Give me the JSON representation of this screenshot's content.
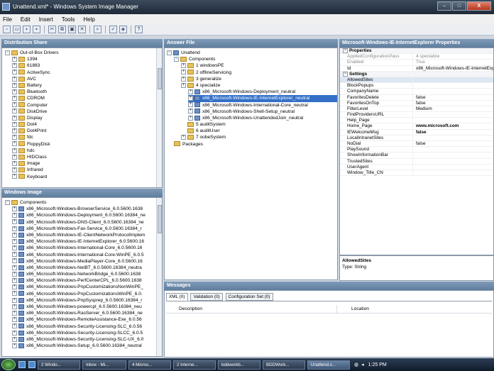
{
  "window": {
    "title": "Unattend.xml* - Windows System Image Manager",
    "min": "–",
    "max": "□",
    "close": "X"
  },
  "menu": [
    "File",
    "Edit",
    "Insert",
    "Tools",
    "Help"
  ],
  "distribution_share": {
    "header": "Distribution Share",
    "root": "Out-of-Box Drivers",
    "items": [
      "1394",
      "61883",
      "ActiveSync",
      "AVC",
      "Battery",
      "Bluetooth",
      "CDROM",
      "Computer",
      "DiskDrive",
      "Display",
      "Dot4",
      "Dot4Print",
      "fdc",
      "FloppyDisk",
      "hdc",
      "HIDClass",
      "Image",
      "Infrared",
      "Keyboard"
    ]
  },
  "windows_image": {
    "header": "Windows Image",
    "root": "Components",
    "items": [
      "x86_Microsoft-Windows-BrowserService_6.0.5600.1638",
      "x86_Microsoft-Windows-Deployment_6.0.5600.16384_ne",
      "x86_Microsoft-Windows-DNS-Client_6.0.5600.16384_ne",
      "x86_Microsoft-Windows-Fax-Service_6.0.5600.16384_r",
      "x86_Microsoft-Windows-IE-ClientNetworkProtocolImplem",
      "x86_Microsoft-Windows-IE-InternetExplorer_6.0.5600.16",
      "x86_Microsoft-Windows-International-Core_6.0.5600.16",
      "x86_Microsoft-Windows-International-Core-WinPE_6.0.5",
      "x86_Microsoft-Windows-MediaPlayer-Core_6.0.5600.16",
      "x86_Microsoft-Windows-NetBT_6.0.5600.16384_neutra",
      "x86_Microsoft-Windows-NetworkBridge_6.0.5600.1638",
      "x86_Microsoft-Windows-PerfCenterCPL_6.0.5600.1638",
      "x86_Microsoft-Windows-PnpCustomizationsNonWinPE_",
      "x86_Microsoft-Windows-PnpCustomizationsWinPE_6.0.",
      "x86_Microsoft-Windows-PnpSysprep_6.0.5600.16384_r",
      "x86_Microsoft-Windows-powercpl_6.0.5600.16384_neu",
      "x86_Microsoft-Windows-RasServer_6.0.5600.16384_ne",
      "x86_Microsoft-Windows-RemoteAssistance-Exe_6.0.56",
      "x86_Microsoft-Windows-Security-Licensing-SLC_6.0.56",
      "x86_Microsoft-Windows-Security-Licensing-SLCC_6.0.5",
      "x86_Microsoft-Windows-Security-Licensing-SLC-UX_6.0",
      "x86_Microsoft-Windows-Setup_6.0.5600.16384_neutral"
    ]
  },
  "answer_file": {
    "header": "Answer File",
    "root": "Unattend",
    "components": "Components",
    "passes": [
      "1 windowsPE",
      "2 offlineServicing",
      "3 generalize",
      "4 specialize"
    ],
    "specialize_items": [
      "x86_Microsoft-Windows-Deployment_neutral",
      "x86_Microsoft-Windows-IE-InternetExplorer_neutral",
      "x86_Microsoft-Windows-International-Core_neutral",
      "x86_Microsoft-Windows-Shell-Setup_neutral",
      "x86_Microsoft-Windows-UnattendedJoin_neutral"
    ],
    "later_passes": [
      "5 auditSystem",
      "6 auditUser",
      "7 oobeSystem"
    ],
    "packages": "Packages"
  },
  "properties": {
    "header": "Microsoft-Windows-IE-InternetExplorer Properties",
    "group_properties": "Properties",
    "rows_top": [
      {
        "name": "AppliedConfigurationPass",
        "value": "4 specialize"
      },
      {
        "name": "Enabled",
        "value": "True"
      },
      {
        "name": "Id",
        "value": "x86_Microsoft-Windows-IE-InternetExplo"
      }
    ],
    "group_settings": "Settings",
    "settings": [
      {
        "name": "AllowedSites",
        "value": ""
      },
      {
        "name": "BlockPopups",
        "value": ""
      },
      {
        "name": "CompanyName",
        "value": ""
      },
      {
        "name": "FavoritesDelete",
        "value": "false"
      },
      {
        "name": "FavoritesOnTop",
        "value": "false"
      },
      {
        "name": "FilterLevel",
        "value": "Medium"
      },
      {
        "name": "FindProvidersURL",
        "value": ""
      },
      {
        "name": "Help_Page",
        "value": ""
      },
      {
        "name": "Home_Page",
        "value": "www.microsoft.com"
      },
      {
        "name": "IEWelcomeMsg",
        "value": "false"
      },
      {
        "name": "LocalIntranetSites",
        "value": ""
      },
      {
        "name": "NoDial",
        "value": "false"
      },
      {
        "name": "PlaySound",
        "value": ""
      },
      {
        "name": "ShowInformationBar",
        "value": ""
      },
      {
        "name": "TrustedSites",
        "value": ""
      },
      {
        "name": "UserAgent",
        "value": ""
      },
      {
        "name": "Window_Title_CN",
        "value": ""
      }
    ],
    "desc_title": "AllowedSites",
    "desc_type": "Type: String"
  },
  "messages": {
    "header": "Messages",
    "tabs": [
      "XML (0)",
      "Validation (0)",
      "Configuration Set (0)"
    ],
    "col_description": "Description",
    "col_location": "Location"
  },
  "taskbar": {
    "buttons": [
      "2 Windo...",
      "Inbox - Mi...",
      "4 Micros...",
      "2 Interne...",
      "bddworkb...",
      "BDDWork...",
      "Unattend.x..."
    ],
    "clock": "1:25 PM"
  }
}
